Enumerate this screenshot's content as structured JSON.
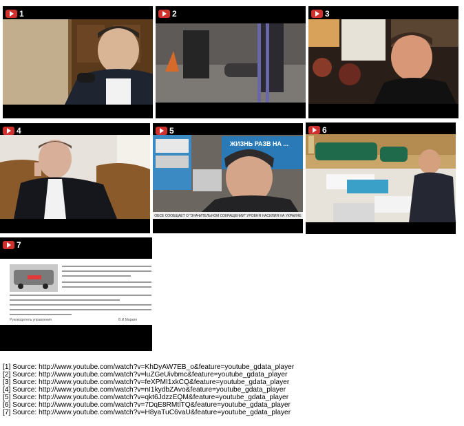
{
  "videos": [
    {
      "index": "1",
      "label": "video-thumbnail-1"
    },
    {
      "index": "2",
      "label": "video-thumbnail-2"
    },
    {
      "index": "3",
      "label": "video-thumbnail-3"
    },
    {
      "index": "4",
      "label": "video-thumbnail-4"
    },
    {
      "index": "5",
      "label": "video-thumbnail-5",
      "tv_banner": "ЖИЗНЬ РАЗВ НА ...",
      "caption": "ОБСЕ СООБЩАЕТ О \"ЗНАЧИТЕЛЬНОМ СОКРАЩЕНИИ\" УРОВНЯ НАСИЛИЯ НА УКРАИНЕ"
    },
    {
      "index": "6",
      "label": "video-thumbnail-6"
    },
    {
      "index": "7",
      "label": "video-thumbnail-7",
      "doc_signature": "Руководитель управления",
      "doc_name": "В.И.Маркин"
    }
  ],
  "sources": [
    "[1] Source: http://www.youtube.com/watch?v=KhDyAW7EB_o&feature=youtube_gdata_player",
    "[2] Source: http://www.youtube.com/watch?v=luZGeUivbmc&feature=youtube_gdata_player",
    "[3] Source: http://www.youtube.com/watch?v=feXPMI1xkCQ&feature=youtube_gdata_player",
    "[4] Source: http://www.youtube.com/watch?v=nI1kydbZAvo&feature=youtube_gdata_player",
    "[5] Source: http://www.youtube.com/watch?v=qkt6JdzzEQM&feature=youtube_gdata_player",
    "[6] Source: http://www.youtube.com/watch?v=7DqE8RMtlTQ&feature=youtube_gdata_player",
    "[7] Source: http://www.youtube.com/watch?v=H8yaTuC6vaU&feature=youtube_gdata_player"
  ],
  "colors": {
    "play_badge": "#d0312d"
  },
  "icons": {
    "play": "play-icon"
  }
}
